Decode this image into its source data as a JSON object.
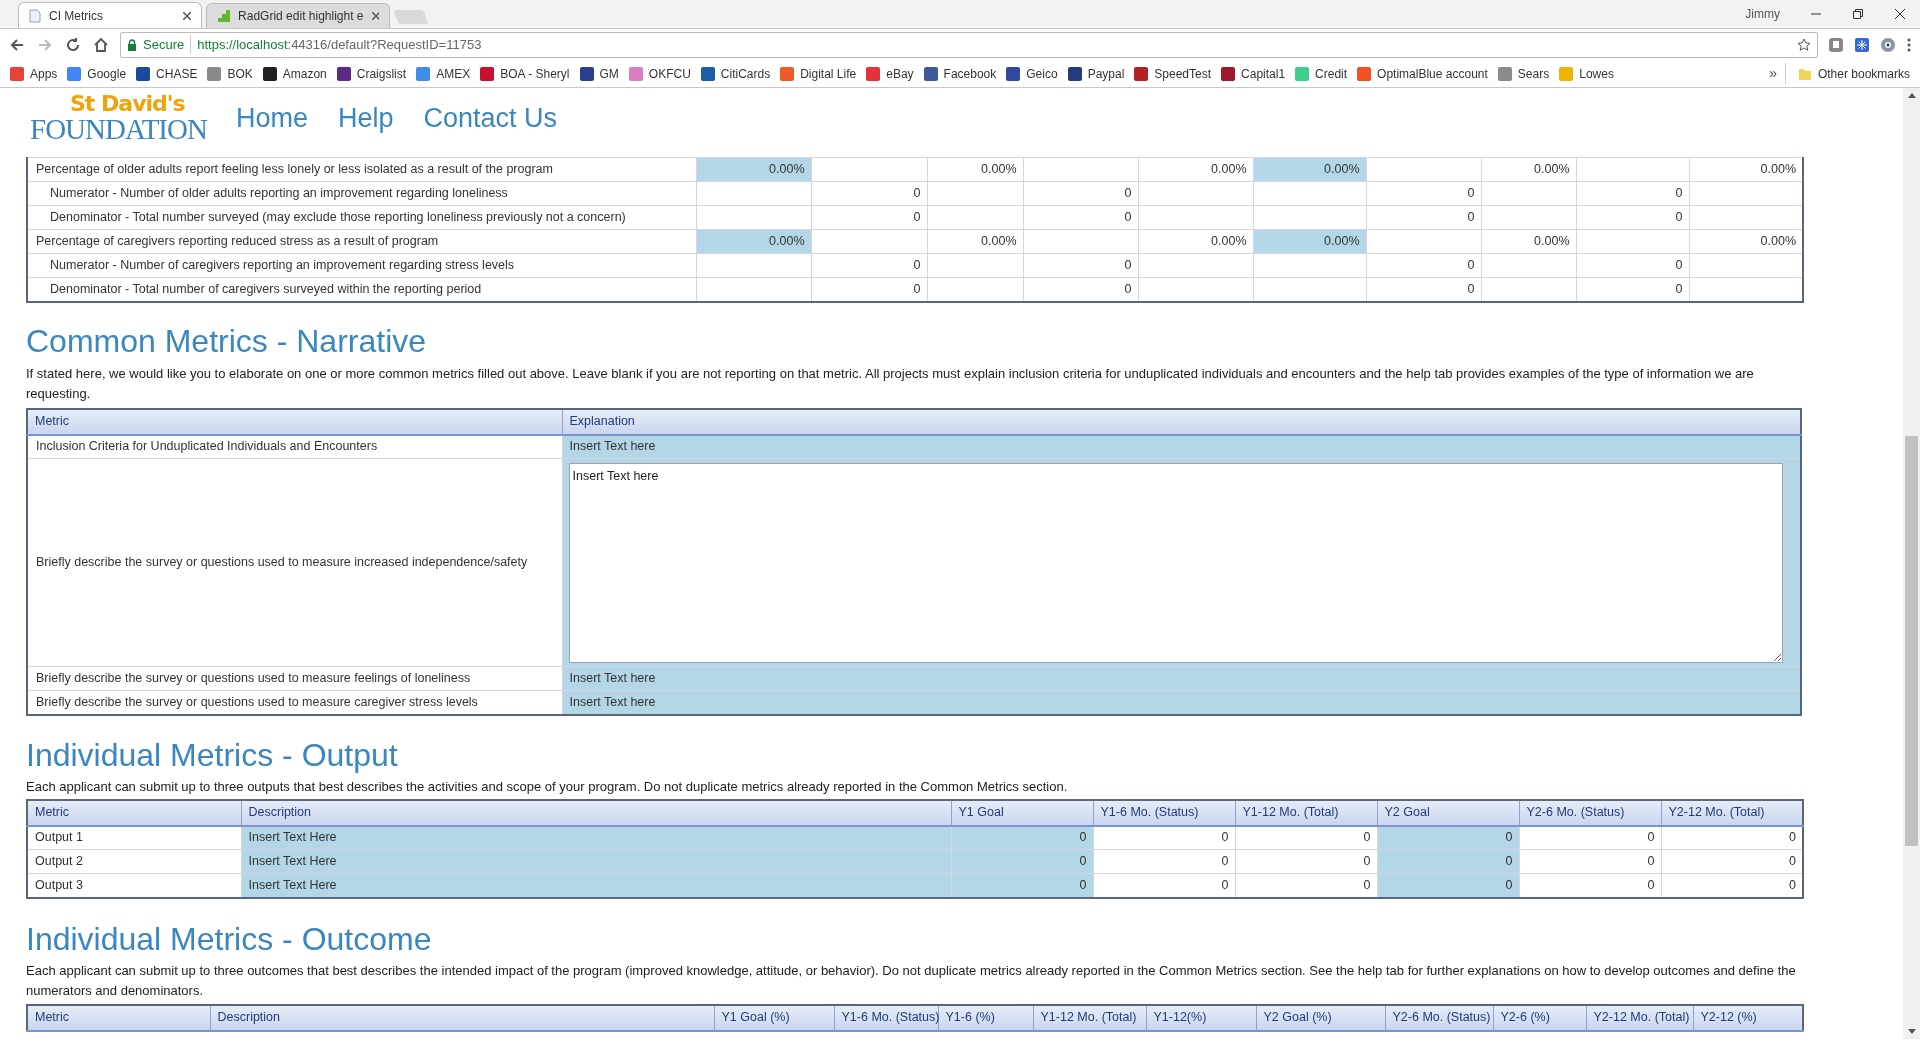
{
  "browser": {
    "tabs": [
      {
        "title": "CI Metrics",
        "selected": true
      },
      {
        "title": "RadGrid edit highlight e",
        "selected": false
      }
    ],
    "profile": "Jimmy",
    "security": "Secure",
    "url_host": "https://localhost",
    "url_path": ":44316/default?RequestID=11753",
    "bookmarks": [
      {
        "label": "Apps",
        "color": "#e94235"
      },
      {
        "label": "Google",
        "color": "#4285f4"
      },
      {
        "label": "CHASE",
        "color": "#1a4a9c"
      },
      {
        "label": "BOK",
        "color": "#8a8a8a"
      },
      {
        "label": "Amazon",
        "color": "#222222"
      },
      {
        "label": "Craigslist",
        "color": "#5b2a86"
      },
      {
        "label": "AMEX",
        "color": "#3d8ee8"
      },
      {
        "label": "BOA - Sheryl",
        "color": "#c8102e"
      },
      {
        "label": "GM",
        "color": "#2b3f8f"
      },
      {
        "label": "OKFCU",
        "color": "#d97cc0"
      },
      {
        "label": "CitiCards",
        "color": "#1b5ea8"
      },
      {
        "label": "Digital Life",
        "color": "#f05a28"
      },
      {
        "label": "eBay",
        "color": "#e53238"
      },
      {
        "label": "Facebook",
        "color": "#3b5998"
      },
      {
        "label": "Geico",
        "color": "#2f4aa0"
      },
      {
        "label": "Paypal",
        "color": "#253b80"
      },
      {
        "label": "SpeedTest",
        "color": "#b22222"
      },
      {
        "label": "Capital1",
        "color": "#a0182b"
      },
      {
        "label": "Credit",
        "color": "#3ecf8e"
      },
      {
        "label": "OptimalBlue account",
        "color": "#f25022"
      },
      {
        "label": "Sears",
        "color": "#8a8a8a"
      },
      {
        "label": "Lowes",
        "color": "#f0b400"
      }
    ],
    "more": "»",
    "other_bookmarks": "Other bookmarks"
  },
  "site": {
    "logo_top": "St David's",
    "logo_bottom": "FOUNDATION",
    "nav": [
      "Home",
      "Help",
      "Contact Us"
    ]
  },
  "common_metrics": {
    "rows": [
      {
        "kind": "percent",
        "label": "Percentage of older adults report feeling less lonely or less isolated as a result of the program",
        "cells": [
          {
            "text": "0.00%",
            "highlighted": true
          },
          null,
          {
            "text": "0.00%",
            "highlighted": false
          },
          null,
          {
            "text": "0.00%",
            "highlighted": false
          },
          {
            "text": "0.00%",
            "highlighted": true
          },
          null,
          {
            "text": "0.00%",
            "highlighted": false
          },
          null,
          {
            "text": "0.00%",
            "highlighted": false
          }
        ]
      },
      {
        "kind": "sub",
        "label": "Numerator - Number of older adults reporting an improvement regarding loneliness",
        "cells": [
          null,
          {
            "text": "0",
            "highlighted": false
          },
          null,
          {
            "text": "0",
            "highlighted": false
          },
          null,
          null,
          {
            "text": "0",
            "highlighted": false
          },
          null,
          {
            "text": "0",
            "highlighted": false
          },
          null
        ]
      },
      {
        "kind": "sub",
        "label": "Denominator - Total number surveyed (may exclude those reporting loneliness previously not a concern)",
        "cells": [
          null,
          {
            "text": "0",
            "highlighted": false
          },
          null,
          {
            "text": "0",
            "highlighted": false
          },
          null,
          null,
          {
            "text": "0",
            "highlighted": false
          },
          null,
          {
            "text": "0",
            "highlighted": false
          },
          null
        ]
      },
      {
        "kind": "percent",
        "label": "Percentage of caregivers reporting reduced stress as a result of program",
        "cells": [
          {
            "text": "0.00%",
            "highlighted": true
          },
          null,
          {
            "text": "0.00%",
            "highlighted": false
          },
          null,
          {
            "text": "0.00%",
            "highlighted": false
          },
          {
            "text": "0.00%",
            "highlighted": true
          },
          null,
          {
            "text": "0.00%",
            "highlighted": false
          },
          null,
          {
            "text": "0.00%",
            "highlighted": false
          }
        ]
      },
      {
        "kind": "sub",
        "label": "Numerator - Number of caregivers reporting an improvement regarding stress levels",
        "cells": [
          null,
          {
            "text": "0",
            "highlighted": false
          },
          null,
          {
            "text": "0",
            "highlighted": false
          },
          null,
          null,
          {
            "text": "0",
            "highlighted": false
          },
          null,
          {
            "text": "0",
            "highlighted": false
          },
          null
        ]
      },
      {
        "kind": "sub",
        "label": "Denominator - Total number of caregivers surveyed within the reporting period",
        "cells": [
          null,
          {
            "text": "0",
            "highlighted": false
          },
          null,
          {
            "text": "0",
            "highlighted": false
          },
          null,
          null,
          {
            "text": "0",
            "highlighted": false
          },
          null,
          {
            "text": "0",
            "highlighted": false
          },
          null
        ]
      }
    ]
  },
  "narrative": {
    "title": "Common Metrics - Narrative",
    "intro": "If stated here, we would like you to elaborate on one or more common metrics filled out above. Leave blank if you are not reporting on that metric. All projects must explain inclusion criteria for unduplicated individuals and encounters and the help tab provides examples of the type of information we are requesting.",
    "columns": [
      "Metric",
      "Explanation"
    ],
    "rows": [
      {
        "kind": "line",
        "metric": "Inclusion Criteria for Unduplicated Individuals and Encounters",
        "explanation": "Insert Text here"
      },
      {
        "kind": "textarea",
        "metric": "Briefly describe the survey or questions used to measure increased independence/safety",
        "explanation": "Insert Text here"
      },
      {
        "kind": "line",
        "metric": "Briefly describe the survey or questions used to measure feelings of loneliness",
        "explanation": "Insert Text here"
      },
      {
        "kind": "line",
        "metric": "Briefly describe the survey or questions used to measure caregiver stress levels",
        "explanation": "Insert Text here"
      }
    ]
  },
  "output": {
    "title": "Individual Metrics - Output",
    "intro": "Each applicant can submit up to three outputs that best describes the activities and scope of your program. Do not duplicate metrics already reported in the Common Metrics section.",
    "columns": [
      {
        "label": "Metric",
        "highlighted": false
      },
      {
        "label": "Description",
        "highlighted": true
      },
      {
        "label": "Y1 Goal",
        "highlighted": true
      },
      {
        "label": "Y1-6 Mo. (Status)",
        "highlighted": false
      },
      {
        "label": "Y1-12 Mo. (Total)",
        "highlighted": false
      },
      {
        "label": "Y2 Goal",
        "highlighted": true
      },
      {
        "label": "Y2-6 Mo. (Status)",
        "highlighted": false
      },
      {
        "label": "Y2-12 Mo. (Total)",
        "highlighted": false
      }
    ],
    "rows": [
      [
        "Output 1",
        "Insert Text Here",
        "0",
        "0",
        "0",
        "0",
        "0",
        "0"
      ],
      [
        "Output 2",
        "Insert Text Here",
        "0",
        "0",
        "0",
        "0",
        "0",
        "0"
      ],
      [
        "Output 3",
        "Insert Text Here",
        "0",
        "0",
        "0",
        "0",
        "0",
        "0"
      ]
    ]
  },
  "outcome": {
    "title": "Individual Metrics - Outcome",
    "intro": "Each applicant can submit up to three outcomes that best describes the intended impact of the program (improved knowledge, attitude, or behavior). Do not duplicate metrics already reported in the Common Metrics section. See the help tab for further explanations on how to develop outcomes and define the numerators and denominators.",
    "columns": [
      "Metric",
      "Description",
      "Y1 Goal (%)",
      "Y1-6 Mo. (Status)",
      "Y1-6 (%)",
      "Y1-12 Mo. (Total)",
      "Y1-12(%)",
      "Y2 Goal (%)",
      "Y2-6 Mo. (Status)",
      "Y2-6 (%)",
      "Y2-12 Mo. (Total)",
      "Y2-12 (%)"
    ]
  }
}
